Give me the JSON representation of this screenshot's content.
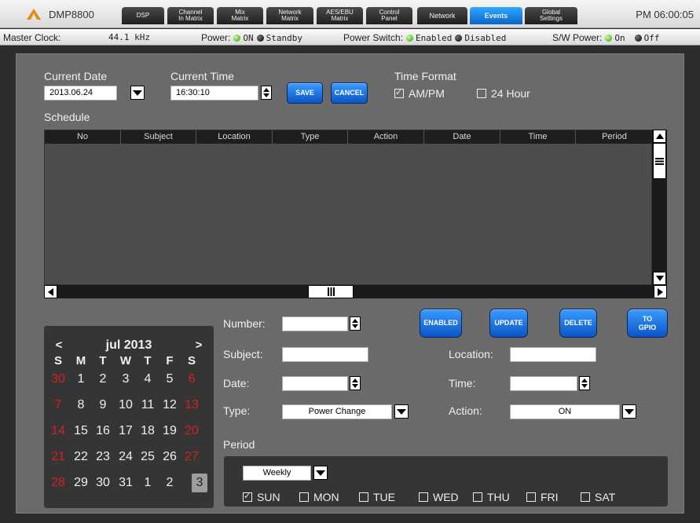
{
  "app": {
    "title": "DMP8800",
    "clock": "PM 06:00:05"
  },
  "nav": {
    "tabs": [
      {
        "label": "DSP"
      },
      {
        "label": "Channel\nIn Matrix"
      },
      {
        "label": "Mix\nMatrix"
      },
      {
        "label": "Network\nMatrix"
      },
      {
        "label": "AES/EBU\nMatrix"
      },
      {
        "label": "Control\nPanel"
      },
      {
        "label": "Network"
      },
      {
        "label": "Events",
        "active": true
      },
      {
        "label": "Global\nSettings"
      }
    ]
  },
  "status": {
    "master_clock_label": "Master Clock:",
    "master_clock_value": "44.1 kHz",
    "power_label": "Power:",
    "power_on": "ON",
    "power_standby": "Standby",
    "power_switch_label": "Power Switch:",
    "ps_enabled": "Enabled",
    "ps_disabled": "Disabled",
    "sw_power_label": "S/W Power:",
    "sw_on": "On",
    "sw_off": "Off"
  },
  "datetime": {
    "current_date_label": "Current Date",
    "current_date_value": "2013.06.24",
    "current_time_label": "Current Time",
    "current_time_value": "16:30:10",
    "save_label": "SAVE",
    "cancel_label": "CANCEL",
    "time_format_label": "Time Format",
    "ampm_label": "AM/PM",
    "ampm_checked": true,
    "hour24_label": "24 Hour",
    "hour24_checked": false
  },
  "schedule": {
    "title": "Schedule",
    "columns": [
      "No",
      "Subject",
      "Location",
      "Type",
      "Action",
      "Date",
      "Time",
      "Period"
    ],
    "rows": []
  },
  "calendar": {
    "prev": "<",
    "next": ">",
    "month_label": "jul 2013",
    "weekdays": [
      "S",
      "M",
      "T",
      "W",
      "T",
      "F",
      "S"
    ],
    "weeks": [
      [
        "30",
        "1",
        "2",
        "3",
        "4",
        "5",
        "6"
      ],
      [
        "7",
        "8",
        "9",
        "10",
        "11",
        "12",
        "13"
      ],
      [
        "14",
        "15",
        "16",
        "17",
        "18",
        "19",
        "20"
      ],
      [
        "21",
        "22",
        "23",
        "24",
        "25",
        "26",
        "27"
      ],
      [
        "28",
        "29",
        "30",
        "31",
        "1",
        "2",
        "3"
      ]
    ],
    "selected": "3"
  },
  "form": {
    "number_label": "Number:",
    "number_value": "",
    "subject_label": "Subject:",
    "subject_value": "",
    "date_label": "Date:",
    "date_value": "",
    "type_label": "Type:",
    "type_value": "Power Change",
    "location_label": "Location:",
    "location_value": "",
    "time_label": "Time:",
    "time_value": "",
    "action_label": "Action:",
    "action_value": "ON",
    "enabled_label": "ENABLED",
    "update_label": "UPDATE",
    "delete_label": "DELETE",
    "to_gpio_label": "TO\nGPIO"
  },
  "period": {
    "label": "Period",
    "mode_value": "Weekly",
    "days": [
      {
        "label": "SUN",
        "checked": true
      },
      {
        "label": "MON",
        "checked": false
      },
      {
        "label": "TUE",
        "checked": false
      },
      {
        "label": "WED",
        "checked": false
      },
      {
        "label": "THU",
        "checked": false
      },
      {
        "label": "FRI",
        "checked": false
      },
      {
        "label": "SAT",
        "checked": false
      }
    ]
  },
  "colors": {
    "accent_blue": "#0a64c8",
    "weekend_red": "#d42020",
    "status_green": "#2a9a11"
  }
}
